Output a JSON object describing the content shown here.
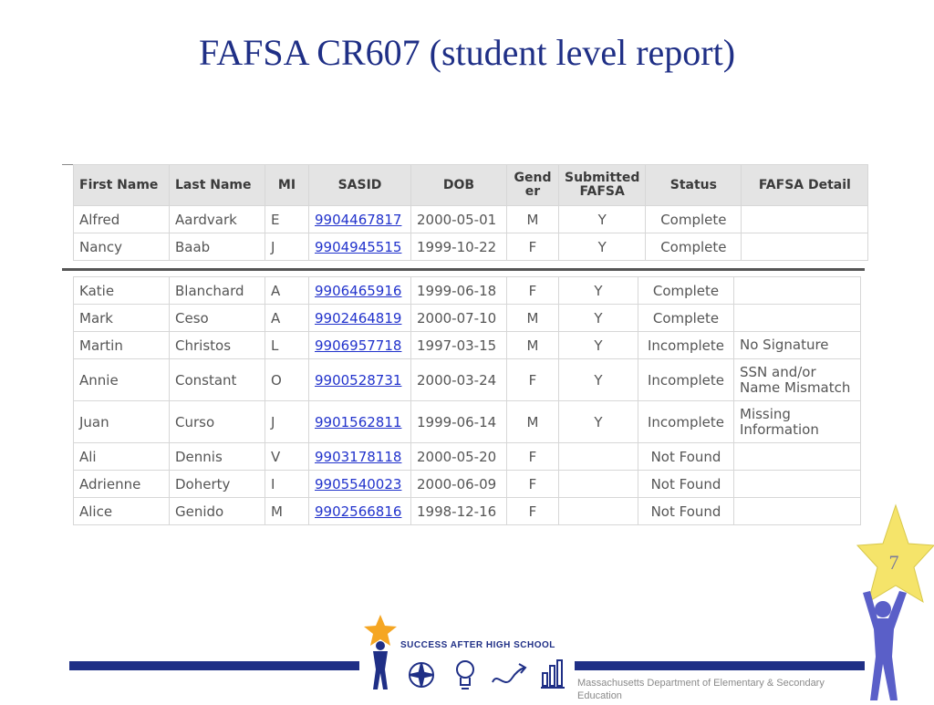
{
  "slide": {
    "title": "FAFSA CR607 (student level report)",
    "page_number": "7",
    "footer": "Massachusetts Department of Elementary & Secondary Education",
    "logo_text": "SUCCESS AFTER HIGH SCHOOL"
  },
  "table": {
    "headers": [
      "First Name",
      "Last Name",
      "MI",
      "SASID",
      "DOB",
      "Gend er",
      "Submitted FAFSA",
      "Status",
      "FAFSA Detail"
    ],
    "rows_top": [
      [
        "Alfred",
        "Aardvark",
        "E",
        "9904467817",
        "2000-05-01",
        "M",
        "Y",
        "Complete",
        ""
      ],
      [
        "Nancy",
        "Baab",
        "J",
        "9904945515",
        "1999-10-22",
        "F",
        "Y",
        "Complete",
        ""
      ]
    ],
    "rows_bottom": [
      [
        "Katie",
        "Blanchard",
        "A",
        "9906465916",
        "1999-06-18",
        "F",
        "Y",
        "Complete",
        ""
      ],
      [
        "Mark",
        "Ceso",
        "A",
        "9902464819",
        "2000-07-10",
        "M",
        "Y",
        "Complete",
        ""
      ],
      [
        "Martin",
        "Christos",
        "L",
        "9906957718",
        "1997-03-15",
        "M",
        "Y",
        "Incomplete",
        "No Signature"
      ],
      [
        "Annie",
        "Constant",
        "O",
        "9900528731",
        "2000-03-24",
        "F",
        "Y",
        "Incomplete",
        "SSN and/or Name Mismatch"
      ],
      [
        "Juan",
        "Curso",
        "J",
        "9901562811",
        "1999-06-14",
        "M",
        "Y",
        "Incomplete",
        "Missing Information"
      ],
      [
        "Ali",
        "Dennis",
        "V",
        "9903178118",
        "2000-05-20",
        "F",
        "",
        "Not Found",
        ""
      ],
      [
        "Adrienne",
        "Doherty",
        "I",
        "9905540023",
        "2000-06-09",
        "F",
        "",
        "Not Found",
        ""
      ],
      [
        "Alice",
        "Genido",
        "M",
        "9902566816",
        "1998-12-16",
        "F",
        "",
        "Not Found",
        ""
      ]
    ]
  },
  "colors": {
    "title": "#1f2f86",
    "link": "#2233cc",
    "star": "#f5e46a",
    "figure": "#5a5fc8"
  },
  "icons": [
    "star-icon",
    "person-icon",
    "compass-icon",
    "lightbulb-icon",
    "arrow-icon",
    "bar-chart-icon"
  ]
}
